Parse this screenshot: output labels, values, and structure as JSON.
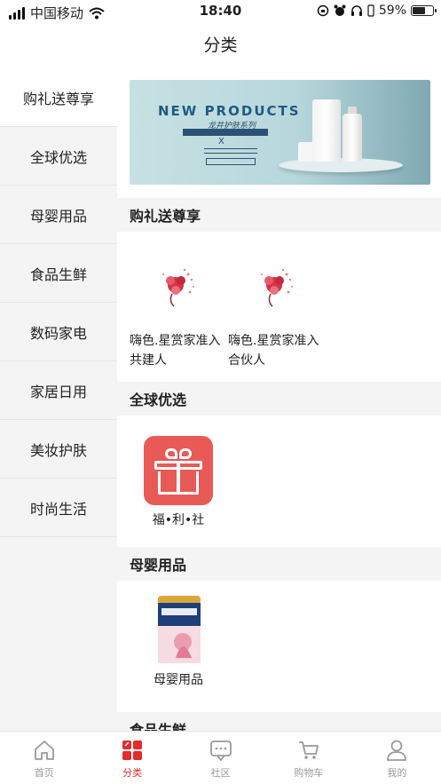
{
  "status_bar": {
    "carrier": "中国移动",
    "time": "18:40",
    "battery": "59%",
    "battery_fraction": 0.59
  },
  "page_title": "分类",
  "sidebar": {
    "items": [
      {
        "label": "购礼送尊享",
        "active": true
      },
      {
        "label": "全球优选",
        "active": false
      },
      {
        "label": "母婴用品",
        "active": false
      },
      {
        "label": "食品生鲜",
        "active": false
      },
      {
        "label": "数码家电",
        "active": false
      },
      {
        "label": "家居日用",
        "active": false
      },
      {
        "label": "美妆护肤",
        "active": false
      },
      {
        "label": "时尚生活",
        "active": false
      }
    ]
  },
  "banner": {
    "headline": "NEW PRODUCTS",
    "subtitle": "龙井护肤系列",
    "cross": "X"
  },
  "sections": [
    {
      "title": "购礼送尊享",
      "products": [
        {
          "name": "嗨色.星赏家准入共建人",
          "icon": "flower-icon"
        },
        {
          "name": "嗨色.星赏家准入合伙人",
          "icon": "flower-icon"
        }
      ]
    },
    {
      "title": "全球优选",
      "products": [
        {
          "name": "福•利•社",
          "icon": "gift-icon"
        }
      ]
    },
    {
      "title": "母婴用品",
      "products": [
        {
          "name": "母婴用品",
          "icon": "formula-can-icon"
        }
      ]
    },
    {
      "title": "食品生鲜",
      "products": []
    }
  ],
  "tabbar": {
    "items": [
      {
        "label": "首页",
        "icon": "home-icon",
        "active": false
      },
      {
        "label": "分类",
        "icon": "category-icon",
        "active": true
      },
      {
        "label": "社区",
        "icon": "community-icon",
        "active": false
      },
      {
        "label": "购物车",
        "icon": "cart-icon",
        "active": false
      },
      {
        "label": "我的",
        "icon": "user-icon",
        "active": false
      }
    ]
  },
  "colors": {
    "accent": "#e32c2c",
    "inactive_tab": "#999999",
    "sidebar_bg": "#f4f4f4"
  }
}
